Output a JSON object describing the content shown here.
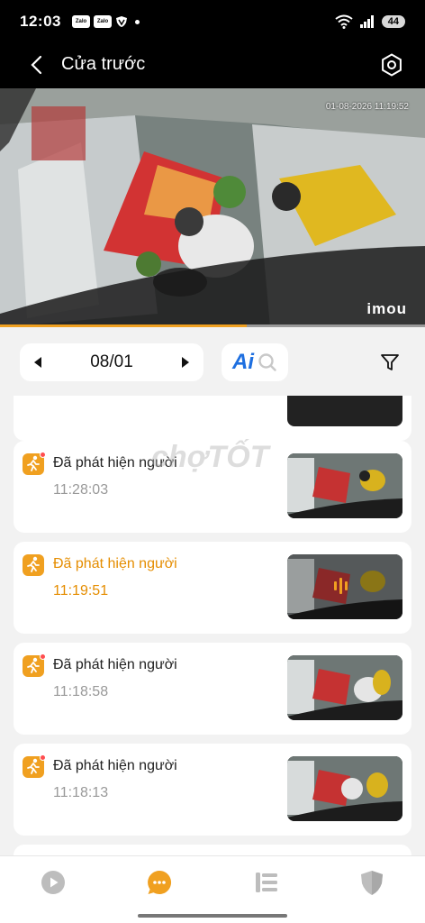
{
  "status_bar": {
    "time": "12:03",
    "notifications": [
      "Zalo",
      "Zalo"
    ],
    "battery": "44"
  },
  "header": {
    "title": "Cửa trước"
  },
  "video": {
    "timestamp": "01-08-2026 11:19:52",
    "brand": "imou",
    "progress": 0.58
  },
  "controls": {
    "date": "08/01",
    "ai_label": "Ai"
  },
  "events": [
    {
      "label": "Đã phát hiện người",
      "time": "11:28:03",
      "active": false
    },
    {
      "label": "Đã phát hiện người",
      "time": "11:19:51",
      "active": true
    },
    {
      "label": "Đã phát hiện người",
      "time": "11:18:58",
      "active": false
    },
    {
      "label": "Đã phát hiện người",
      "time": "11:18:13",
      "active": false
    }
  ],
  "watermark": "chợTỐT",
  "colors": {
    "accent": "#f0a020",
    "ai_blue": "#1e6fe0",
    "active_text": "#e58d00"
  },
  "icons": {
    "nav": [
      "play-icon",
      "message-icon",
      "list-icon",
      "shield-icon"
    ]
  }
}
